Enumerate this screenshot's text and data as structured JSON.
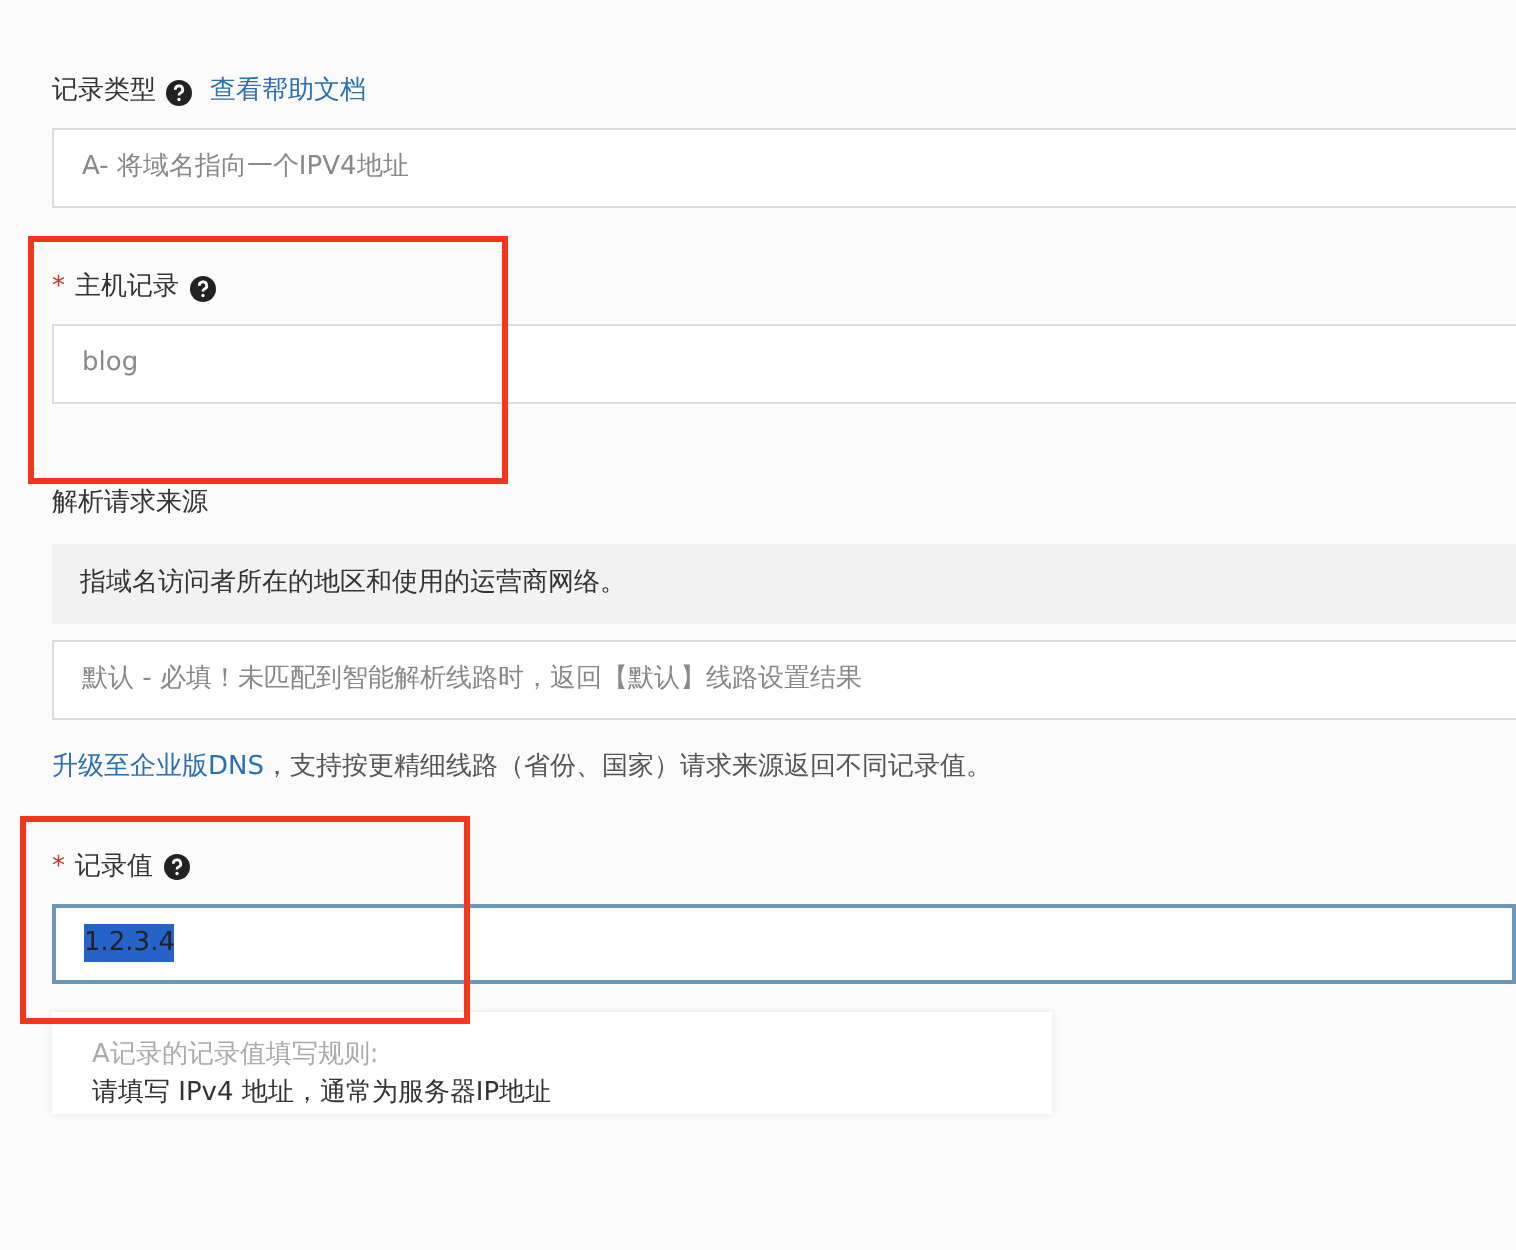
{
  "sections": [
    {
      "kind": "select",
      "label": "记录类型",
      "help": true,
      "link": "查看帮助文档",
      "value": "A- 将域名指向一个IPV4地址"
    },
    {
      "kind": "input",
      "required_mark": "*",
      "label": "主机记录",
      "help": true,
      "value": "blog",
      "focused": false,
      "text_selected": false,
      "highlighted": true
    },
    {
      "kind": "source",
      "label": "解析请求来源",
      "info": "指域名访问者所在的地区和使用的运营商网络。",
      "value": "默认 - 必填！未匹配到智能解析线路时，返回【默认】线路设置结果",
      "upgrade_link": "升级至企业版DNS",
      "upgrade_text": "，支持按更精细线路（省份、国家）请求来源返回不同记录值。"
    },
    {
      "kind": "input",
      "required_mark": "*",
      "label": "记录值",
      "help": true,
      "value": "1.2.3.4",
      "focused": true,
      "text_selected": true,
      "highlighted": true,
      "hint_title": "A记录的记录值填写规则:",
      "hint_text": "请填写 IPv4 地址，通常为服务器IP地址"
    }
  ]
}
